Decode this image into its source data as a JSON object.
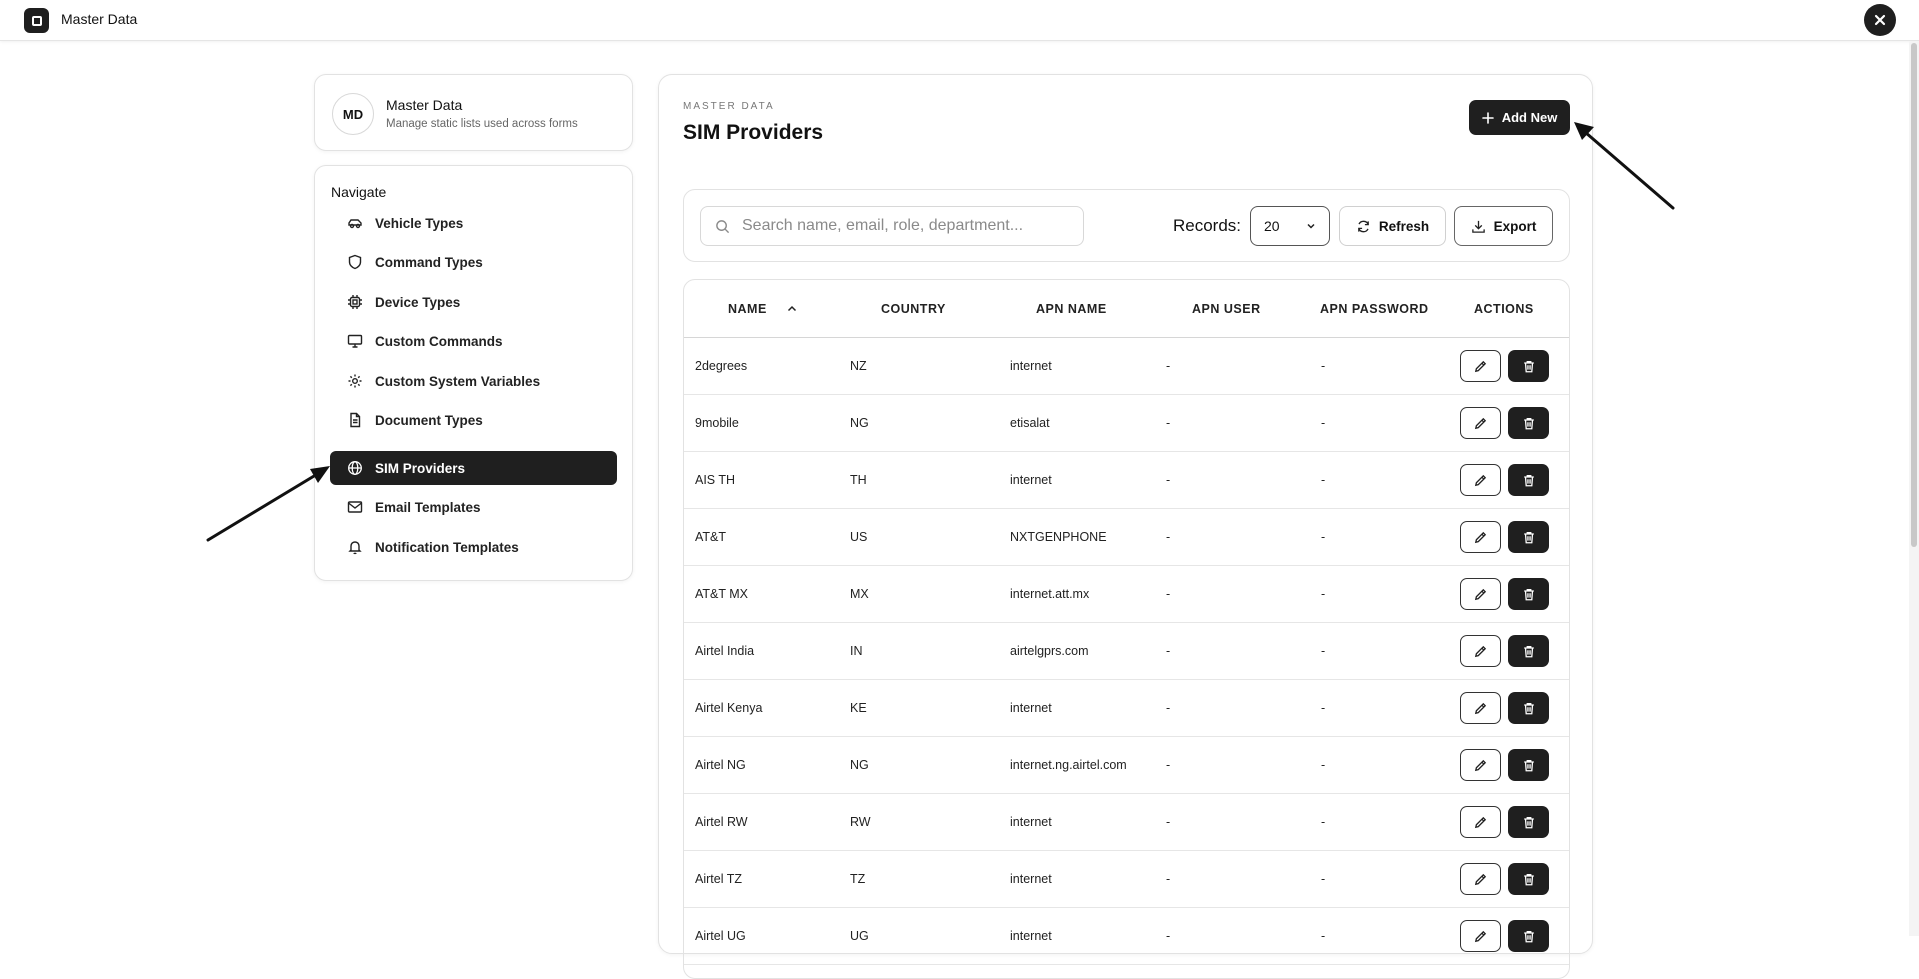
{
  "topbar": {
    "title": "Master Data",
    "close_label": "×"
  },
  "header_card": {
    "avatar": "MD",
    "title": "Master Data",
    "subtitle": "Manage static lists used across forms"
  },
  "nav": {
    "title": "Navigate",
    "items": [
      {
        "label": "Vehicle Types",
        "icon": "car-icon",
        "active": false
      },
      {
        "label": "Command Types",
        "icon": "shield-icon",
        "active": false
      },
      {
        "label": "Device Types",
        "icon": "chip-icon",
        "active": false
      },
      {
        "label": "Custom Commands",
        "icon": "monitor-icon",
        "active": false
      },
      {
        "label": "Custom System Variables",
        "icon": "gear-icon",
        "active": false
      },
      {
        "label": "Document Types",
        "icon": "document-icon",
        "active": false
      },
      {
        "label": "SIM Providers",
        "icon": "globe-icon",
        "active": true
      },
      {
        "label": "Email Templates",
        "icon": "mail-icon",
        "active": false
      },
      {
        "label": "Notification Templates",
        "icon": "bell-icon",
        "active": false
      }
    ]
  },
  "main": {
    "eyebrow": "MASTER DATA",
    "title": "SIM Providers",
    "add_button": "Add New",
    "search": {
      "placeholder": "Search name, email, role, department...",
      "value": ""
    },
    "records_label": "Records:",
    "records_value": "20",
    "refresh_label": "Refresh",
    "export_label": "Export"
  },
  "table": {
    "columns": [
      "NAME",
      "COUNTRY",
      "APN NAME",
      "APN USER",
      "APN PASSWORD",
      "ACTIONS"
    ],
    "sort": {
      "column": "NAME",
      "direction": "asc"
    },
    "rows": [
      [
        "2degrees",
        "NZ",
        "internet",
        "-",
        "-"
      ],
      [
        "9mobile",
        "NG",
        "etisalat",
        "-",
        "-"
      ],
      [
        "AIS TH",
        "TH",
        "internet",
        "-",
        "-"
      ],
      [
        "AT&T",
        "US",
        "NXTGENPHONE",
        "-",
        "-"
      ],
      [
        "AT&T MX",
        "MX",
        "internet.att.mx",
        "-",
        "-"
      ],
      [
        "Airtel India",
        "IN",
        "airtelgprs.com",
        "-",
        "-"
      ],
      [
        "Airtel Kenya",
        "KE",
        "internet",
        "-",
        "-"
      ],
      [
        "Airtel NG",
        "NG",
        "internet.ng.airtel.com",
        "-",
        "-"
      ],
      [
        "Airtel RW",
        "RW",
        "internet",
        "-",
        "-"
      ],
      [
        "Airtel TZ",
        "TZ",
        "internet",
        "-",
        "-"
      ],
      [
        "Airtel UG",
        "UG",
        "internet",
        "-",
        "-"
      ]
    ]
  },
  "colors": {
    "accent": "#1f1f1f",
    "border": "#e2e2e2",
    "background": "#ffffff"
  }
}
